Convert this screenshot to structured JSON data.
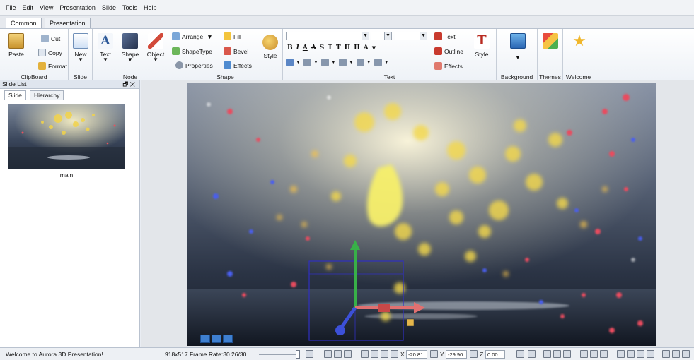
{
  "menu": [
    "File",
    "Edit",
    "View",
    "Presentation",
    "Slide",
    "Tools",
    "Help"
  ],
  "tabs": [
    "Common",
    "Presentation"
  ],
  "ribbon": {
    "clipboard": {
      "caption": "ClipBoard",
      "paste": "Paste",
      "cut": "Cut",
      "copy": "Copy",
      "format": "Format"
    },
    "slide": {
      "caption": "Slide",
      "new": "New"
    },
    "node": {
      "caption": "Node",
      "text": "Text",
      "shape": "Shape",
      "object": "Object"
    },
    "shape": {
      "caption": "Shape",
      "arrange": "Arrange",
      "fill": "Fill",
      "shapetype": "ShapeType",
      "bevel": "Bevel",
      "properties": "Properties",
      "effects": "Effects",
      "style": "Style"
    },
    "text": {
      "caption": "Text",
      "text": "Text",
      "outline": "Outline",
      "effects": "Effects",
      "style": "Style",
      "format_glyphs": [
        "B",
        "I",
        "A",
        "A",
        "S",
        "T",
        "T",
        "Π",
        "Π",
        "A"
      ]
    },
    "background": {
      "caption": "Background"
    },
    "themes": {
      "caption": "Themes"
    },
    "welcome": {
      "caption": "Welcome"
    }
  },
  "slide_list": {
    "title": "Slide List",
    "controls": "🗗 ✕",
    "tabs": [
      "Slide",
      "Hierarchy"
    ],
    "slides": [
      {
        "label": "main"
      }
    ]
  },
  "status": {
    "message": "Welcome to Aurora 3D Presentation!",
    "size_frame": "918x517 Frame Rate:30.26/30",
    "x_label": "X",
    "x_value": "-20.81",
    "y_label": "Y",
    "y_value": "-29.90",
    "z_label": "Z",
    "z_value": "0.00"
  },
  "colors": {
    "accent": "#3b6cc4",
    "ribbon_border": "#b9c2cf",
    "gizmo_x": "#e05a5a",
    "gizmo_y": "#38b048",
    "gizmo_z": "#3c50d8",
    "selection": "#3030c0"
  }
}
